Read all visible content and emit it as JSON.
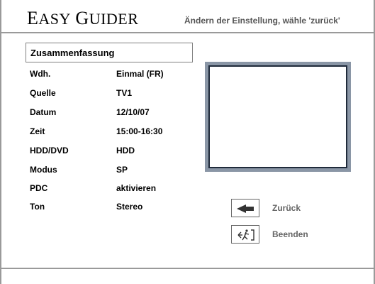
{
  "header": {
    "brand_e": "E",
    "brand_asy": "ASY",
    "brand_g": "G",
    "brand_uider": "UIDER",
    "hint": "Ändern der Einstellung, wähle 'zurück'"
  },
  "summary": {
    "title": "Zusammenfassung",
    "rows": [
      {
        "label": "Wdh.",
        "value": "Einmal (FR)"
      },
      {
        "label": "Quelle",
        "value": "TV1"
      },
      {
        "label": "Datum",
        "value": "12/10/07"
      },
      {
        "label": "Zeit",
        "value": "15:00-16:30"
      },
      {
        "label": "HDD/DVD",
        "value": "HDD"
      },
      {
        "label": "Modus",
        "value": "SP"
      },
      {
        "label": "PDC",
        "value": "aktivieren"
      },
      {
        "label": "Ton",
        "value": "Stereo"
      }
    ]
  },
  "nav": {
    "back": {
      "label": "Zurück",
      "icon": "back-arrow-icon"
    },
    "exit": {
      "label": "Beenden",
      "icon": "exit-icon"
    }
  }
}
